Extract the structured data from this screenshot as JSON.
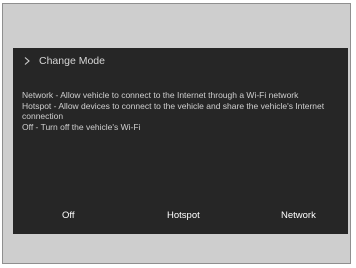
{
  "header": {
    "icon": "chevron-right-icon",
    "title": "Change Mode"
  },
  "descriptions": [
    "Network - Allow vehicle to connect to the Internet through a Wi-Fi network",
    "Hotspot - Allow devices to connect to the vehicle and share the vehicle's Internet connection",
    "Off - Turn off the vehicle's Wi-Fi"
  ],
  "buttons": {
    "off": "Off",
    "hotspot": "Hotspot",
    "network": "Network"
  },
  "colors": {
    "screen_background": "#262626",
    "frame_background": "#cecece",
    "text": "#cfcfcf",
    "button_text": "#ffffff"
  }
}
